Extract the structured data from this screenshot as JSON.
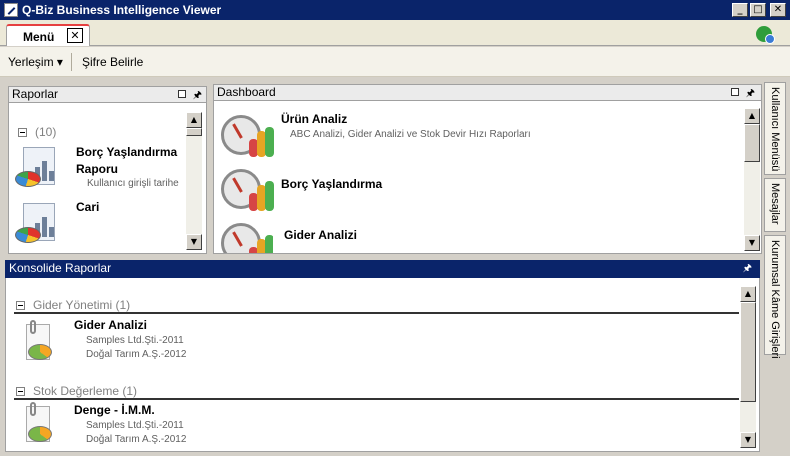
{
  "window": {
    "title": "Q-Biz Business Intelligence Viewer",
    "minimize": "_",
    "maximize": "□",
    "close": "✕"
  },
  "tabs": {
    "menu_label": "Menü",
    "menu_close": "✕"
  },
  "toolbar": {
    "layout_label": "Yerleşim ▾",
    "change_password_label": "Şifre Belirle"
  },
  "raporlar": {
    "title": "Raporlar",
    "group_label": "(10)",
    "items": [
      {
        "title_line1": "Borç Yaşlandırma",
        "title_line2": "Raporu",
        "subtitle": "Kullanıcı girişli tarihe"
      },
      {
        "title_line1": "Cari",
        "title_line2": "",
        "subtitle": ""
      }
    ]
  },
  "dashboard": {
    "title": "Dashboard",
    "items": [
      {
        "title": "Ürün Analiz",
        "subtitle": "ABC Analizi, Gider Analizi ve Stok Devir Hızı Raporları"
      },
      {
        "title": "Borç Yaşlandırma",
        "subtitle": ""
      },
      {
        "title": "Gider Analizi",
        "subtitle": ""
      }
    ]
  },
  "konsolide": {
    "title": "Konsolide Raporlar",
    "groups": [
      {
        "label": "Gider Yönetimi (1)",
        "item_title": "Gider Analizi",
        "lines": [
          "Samples Ltd.Şti.-2011",
          "Doğal Tarım A.Ş.-2012"
        ]
      },
      {
        "label": "Stok Değerleme (1)",
        "item_title": "Denge - İ.M.M.",
        "lines": [
          "Samples Ltd.Şti.-2011",
          "Doğal Tarım A.Ş.-2012"
        ]
      }
    ]
  },
  "side_tabs": {
    "user_menu": "Kullanıcı Menüsü",
    "messages": "Mesajlar",
    "corporate": "Kurumsal Kâme Girişleri"
  },
  "scroll": {
    "up": "▲",
    "down": "▼"
  },
  "icons": {
    "app": "app-icon",
    "user_status": "user-status-icon",
    "pin": "pin-icon"
  }
}
